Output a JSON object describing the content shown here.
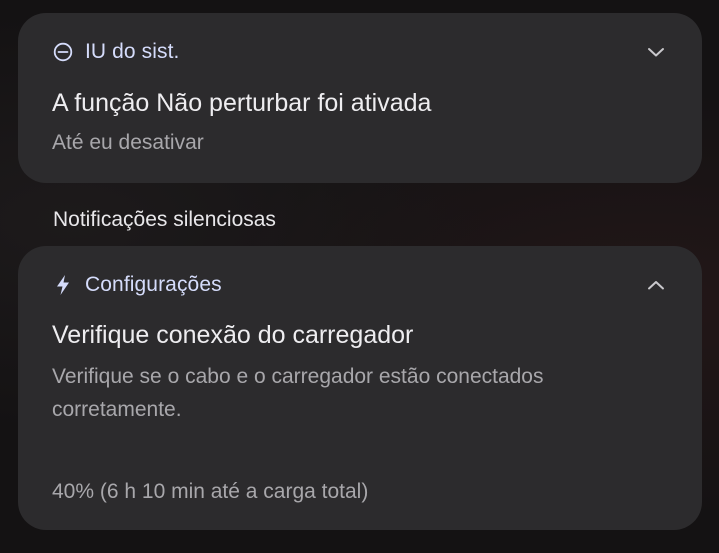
{
  "notifications": [
    {
      "app_name": "IU do sist.",
      "icon": "do-not-disturb-icon",
      "title": "A função Não perturbar foi ativada",
      "subtitle": "Até eu desativar",
      "expanded": false
    },
    {
      "app_name": "Configurações",
      "icon": "lightning-bolt-icon",
      "title": "Verifique conexão do carregador",
      "body": "Verifique se o cabo e o carregador estão conectados corretamente.",
      "progress_text": "40% (6 h 10 min até a carga total)",
      "expanded": true
    }
  ],
  "section_header": "Notificações silenciosas",
  "colors": {
    "background": "#141213",
    "card": "#2c2b2d",
    "app_name": "#d5dcfb",
    "title": "#eeedf0",
    "secondary": "#a8a7ab"
  }
}
